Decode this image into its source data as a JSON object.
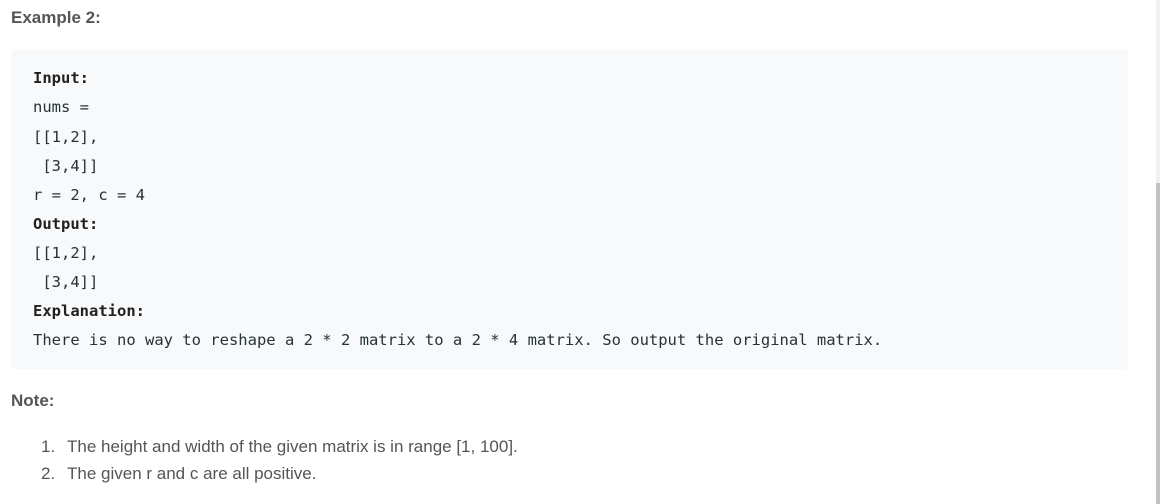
{
  "example": {
    "heading": "Example 2:",
    "code_lines": [
      {
        "text": "Input:",
        "bold": true
      },
      {
        "text": "nums =",
        "bold": false
      },
      {
        "text": "[[1,2],",
        "bold": false
      },
      {
        "text": " [3,4]]",
        "bold": false
      },
      {
        "text": "r = 2, c = 4",
        "bold": false
      },
      {
        "text": "Output:",
        "bold": true
      },
      {
        "text": "[[1,2],",
        "bold": false
      },
      {
        "text": " [3,4]]",
        "bold": false
      },
      {
        "text": "Explanation:",
        "bold": true
      },
      {
        "text": "There is no way to reshape a 2 * 2 matrix to a 2 * 4 matrix. So output the original matrix.",
        "bold": false
      }
    ]
  },
  "note": {
    "heading": "Note:",
    "items": [
      {
        "number": "1.",
        "text": "The height and width of the given matrix is in range [1, 100]."
      },
      {
        "number": "2.",
        "text": "The given r and c are all positive."
      }
    ]
  }
}
